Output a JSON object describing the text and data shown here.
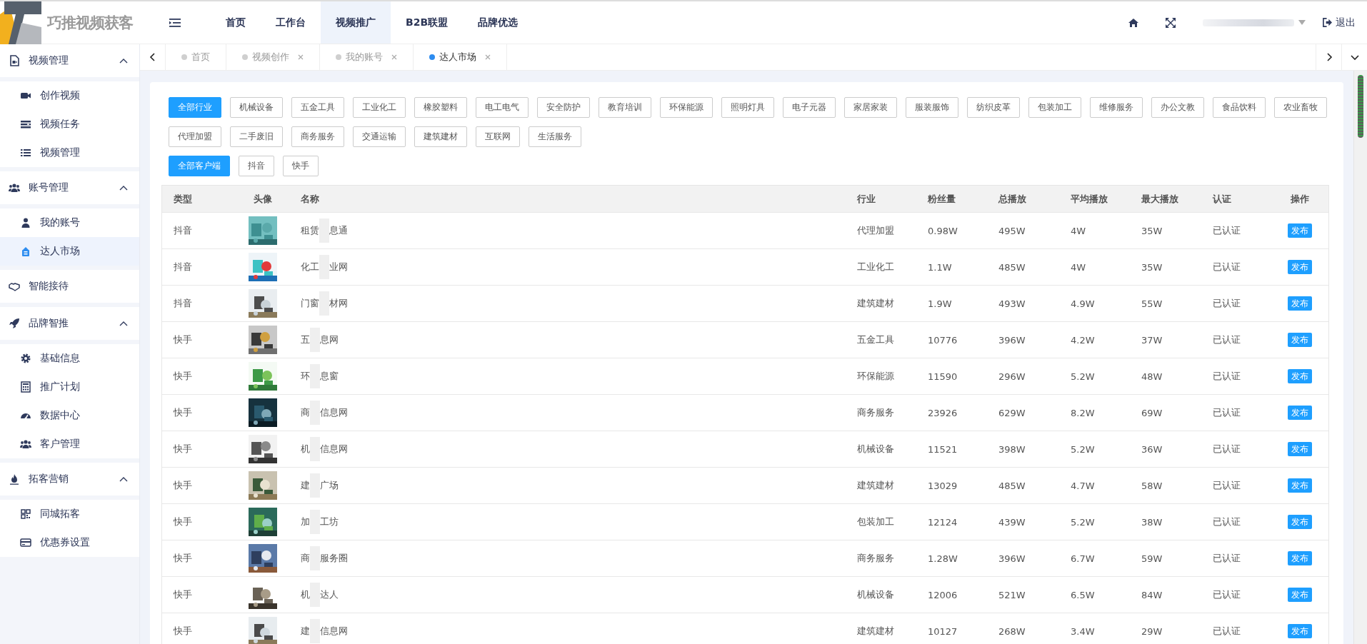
{
  "app": {
    "title": "巧推视频获客"
  },
  "nav": [
    {
      "label": "首页",
      "selected": false
    },
    {
      "label": "工作台",
      "selected": false
    },
    {
      "label": "视频推广",
      "selected": true
    },
    {
      "label": "B2B联盟",
      "selected": false
    },
    {
      "label": "品牌优选",
      "selected": false
    }
  ],
  "header_actions": {
    "logout": "退出"
  },
  "sidebar": [
    {
      "label": "视频管理",
      "expanded": true,
      "children": [
        {
          "label": "创作视频",
          "selected": false
        },
        {
          "label": "视频任务",
          "selected": false
        },
        {
          "label": "视频管理",
          "selected": false
        }
      ]
    },
    {
      "label": "账号管理",
      "expanded": true,
      "children": [
        {
          "label": "我的账号",
          "selected": false
        },
        {
          "label": "达人市场",
          "selected": true
        }
      ]
    },
    {
      "label": "智能接待"
    },
    {
      "label": "品牌智推",
      "expanded": true,
      "children": [
        {
          "label": "基础信息",
          "selected": false
        },
        {
          "label": "推广计划",
          "selected": false
        },
        {
          "label": "数据中心",
          "selected": false
        },
        {
          "label": "客户管理",
          "selected": false
        }
      ]
    },
    {
      "label": "拓客营销",
      "expanded": true,
      "children": [
        {
          "label": "同城拓客",
          "selected": false
        },
        {
          "label": "优惠券设置",
          "selected": false
        }
      ]
    }
  ],
  "tabs": [
    {
      "label": "首页",
      "selected": false,
      "closable": false
    },
    {
      "label": "视频创作",
      "selected": false,
      "closable": true
    },
    {
      "label": "我的账号",
      "selected": false,
      "closable": true
    },
    {
      "label": "达人市场",
      "selected": true,
      "closable": true
    }
  ],
  "industry_filters": [
    {
      "label": "全部行业",
      "selected": true
    },
    {
      "label": "机械设备",
      "selected": false
    },
    {
      "label": "五金工具",
      "selected": false
    },
    {
      "label": "工业化工",
      "selected": false
    },
    {
      "label": "橡胶塑料",
      "selected": false
    },
    {
      "label": "电工电气",
      "selected": false
    },
    {
      "label": "安全防护",
      "selected": false
    },
    {
      "label": "教育培训",
      "selected": false
    },
    {
      "label": "环保能源",
      "selected": false
    },
    {
      "label": "照明灯具",
      "selected": false
    },
    {
      "label": "电子元器",
      "selected": false
    },
    {
      "label": "家居家装",
      "selected": false
    },
    {
      "label": "服装服饰",
      "selected": false
    },
    {
      "label": "纺织皮革",
      "selected": false
    },
    {
      "label": "包装加工",
      "selected": false
    },
    {
      "label": "维修服务",
      "selected": false
    },
    {
      "label": "办公文教",
      "selected": false
    },
    {
      "label": "食品饮料",
      "selected": false
    },
    {
      "label": "农业畜牧",
      "selected": false
    },
    {
      "label": "代理加盟",
      "selected": false
    },
    {
      "label": "二手废旧",
      "selected": false
    },
    {
      "label": "商务服务",
      "selected": false
    },
    {
      "label": "交通运输",
      "selected": false
    },
    {
      "label": "建筑建材",
      "selected": false
    },
    {
      "label": "互联网",
      "selected": false
    },
    {
      "label": "生活服务",
      "selected": false
    }
  ],
  "client_filters": [
    {
      "label": "全部客户端",
      "selected": true
    },
    {
      "label": "抖音",
      "selected": false
    },
    {
      "label": "快手",
      "selected": false
    }
  ],
  "table": {
    "columns": [
      "类型",
      "头像",
      "名称",
      "行业",
      "粉丝量",
      "总播放",
      "平均播放",
      "最大播放",
      "认证",
      "操作"
    ],
    "rows": [
      {
        "type": "抖音",
        "name_start": "租赁",
        "name_end": "息通",
        "industry": "代理加盟",
        "fans": "0.98W",
        "total": "495W",
        "avg": "4W",
        "max": "35W",
        "cert": "已认证",
        "action": "发布"
      },
      {
        "type": "抖音",
        "name_start": "化工",
        "name_end": "业网",
        "industry": "工业化工",
        "fans": "1.1W",
        "total": "485W",
        "avg": "4W",
        "max": "35W",
        "cert": "已认证",
        "action": "发布"
      },
      {
        "type": "抖音",
        "name_start": "门窗",
        "name_end": "材网",
        "industry": "建筑建材",
        "fans": "1.9W",
        "total": "493W",
        "avg": "4.9W",
        "max": "55W",
        "cert": "已认证",
        "action": "发布"
      },
      {
        "type": "快手",
        "name_start": "五",
        "name_end": "息网",
        "industry": "五金工具",
        "fans": "10776",
        "total": "396W",
        "avg": "4.2W",
        "max": "37W",
        "cert": "已认证",
        "action": "发布"
      },
      {
        "type": "快手",
        "name_start": "环",
        "name_end": "息窗",
        "industry": "环保能源",
        "fans": "11590",
        "total": "296W",
        "avg": "5.2W",
        "max": "48W",
        "cert": "已认证",
        "action": "发布"
      },
      {
        "type": "快手",
        "name_start": "商",
        "name_end": "信息网",
        "industry": "商务服务",
        "fans": "23926",
        "total": "629W",
        "avg": "8.2W",
        "max": "69W",
        "cert": "已认证",
        "action": "发布"
      },
      {
        "type": "快手",
        "name_start": "机",
        "name_end": "信息网",
        "industry": "机械设备",
        "fans": "11521",
        "total": "398W",
        "avg": "5.2W",
        "max": "36W",
        "cert": "已认证",
        "action": "发布"
      },
      {
        "type": "快手",
        "name_start": "建",
        "name_end": "广场",
        "industry": "建筑建材",
        "fans": "13029",
        "total": "485W",
        "avg": "4.7W",
        "max": "58W",
        "cert": "已认证",
        "action": "发布"
      },
      {
        "type": "快手",
        "name_start": "加",
        "name_end": "工坊",
        "industry": "包装加工",
        "fans": "12124",
        "total": "439W",
        "avg": "5.2W",
        "max": "38W",
        "cert": "已认证",
        "action": "发布"
      },
      {
        "type": "快手",
        "name_start": "商",
        "name_end": "服务圈",
        "industry": "商务服务",
        "fans": "1.28W",
        "total": "396W",
        "avg": "6.7W",
        "max": "59W",
        "cert": "已认证",
        "action": "发布"
      },
      {
        "type": "快手",
        "name_start": "机",
        "name_end": "达人",
        "industry": "机械设备",
        "fans": "12006",
        "total": "521W",
        "avg": "6.5W",
        "max": "84W",
        "cert": "已认证",
        "action": "发布"
      },
      {
        "type": "快手",
        "name_start": "建",
        "name_end": "信息网",
        "industry": "建筑建材",
        "fans": "10127",
        "total": "268W",
        "avg": "3.4W",
        "max": "29W",
        "cert": "已认证",
        "action": "发布"
      }
    ]
  }
}
